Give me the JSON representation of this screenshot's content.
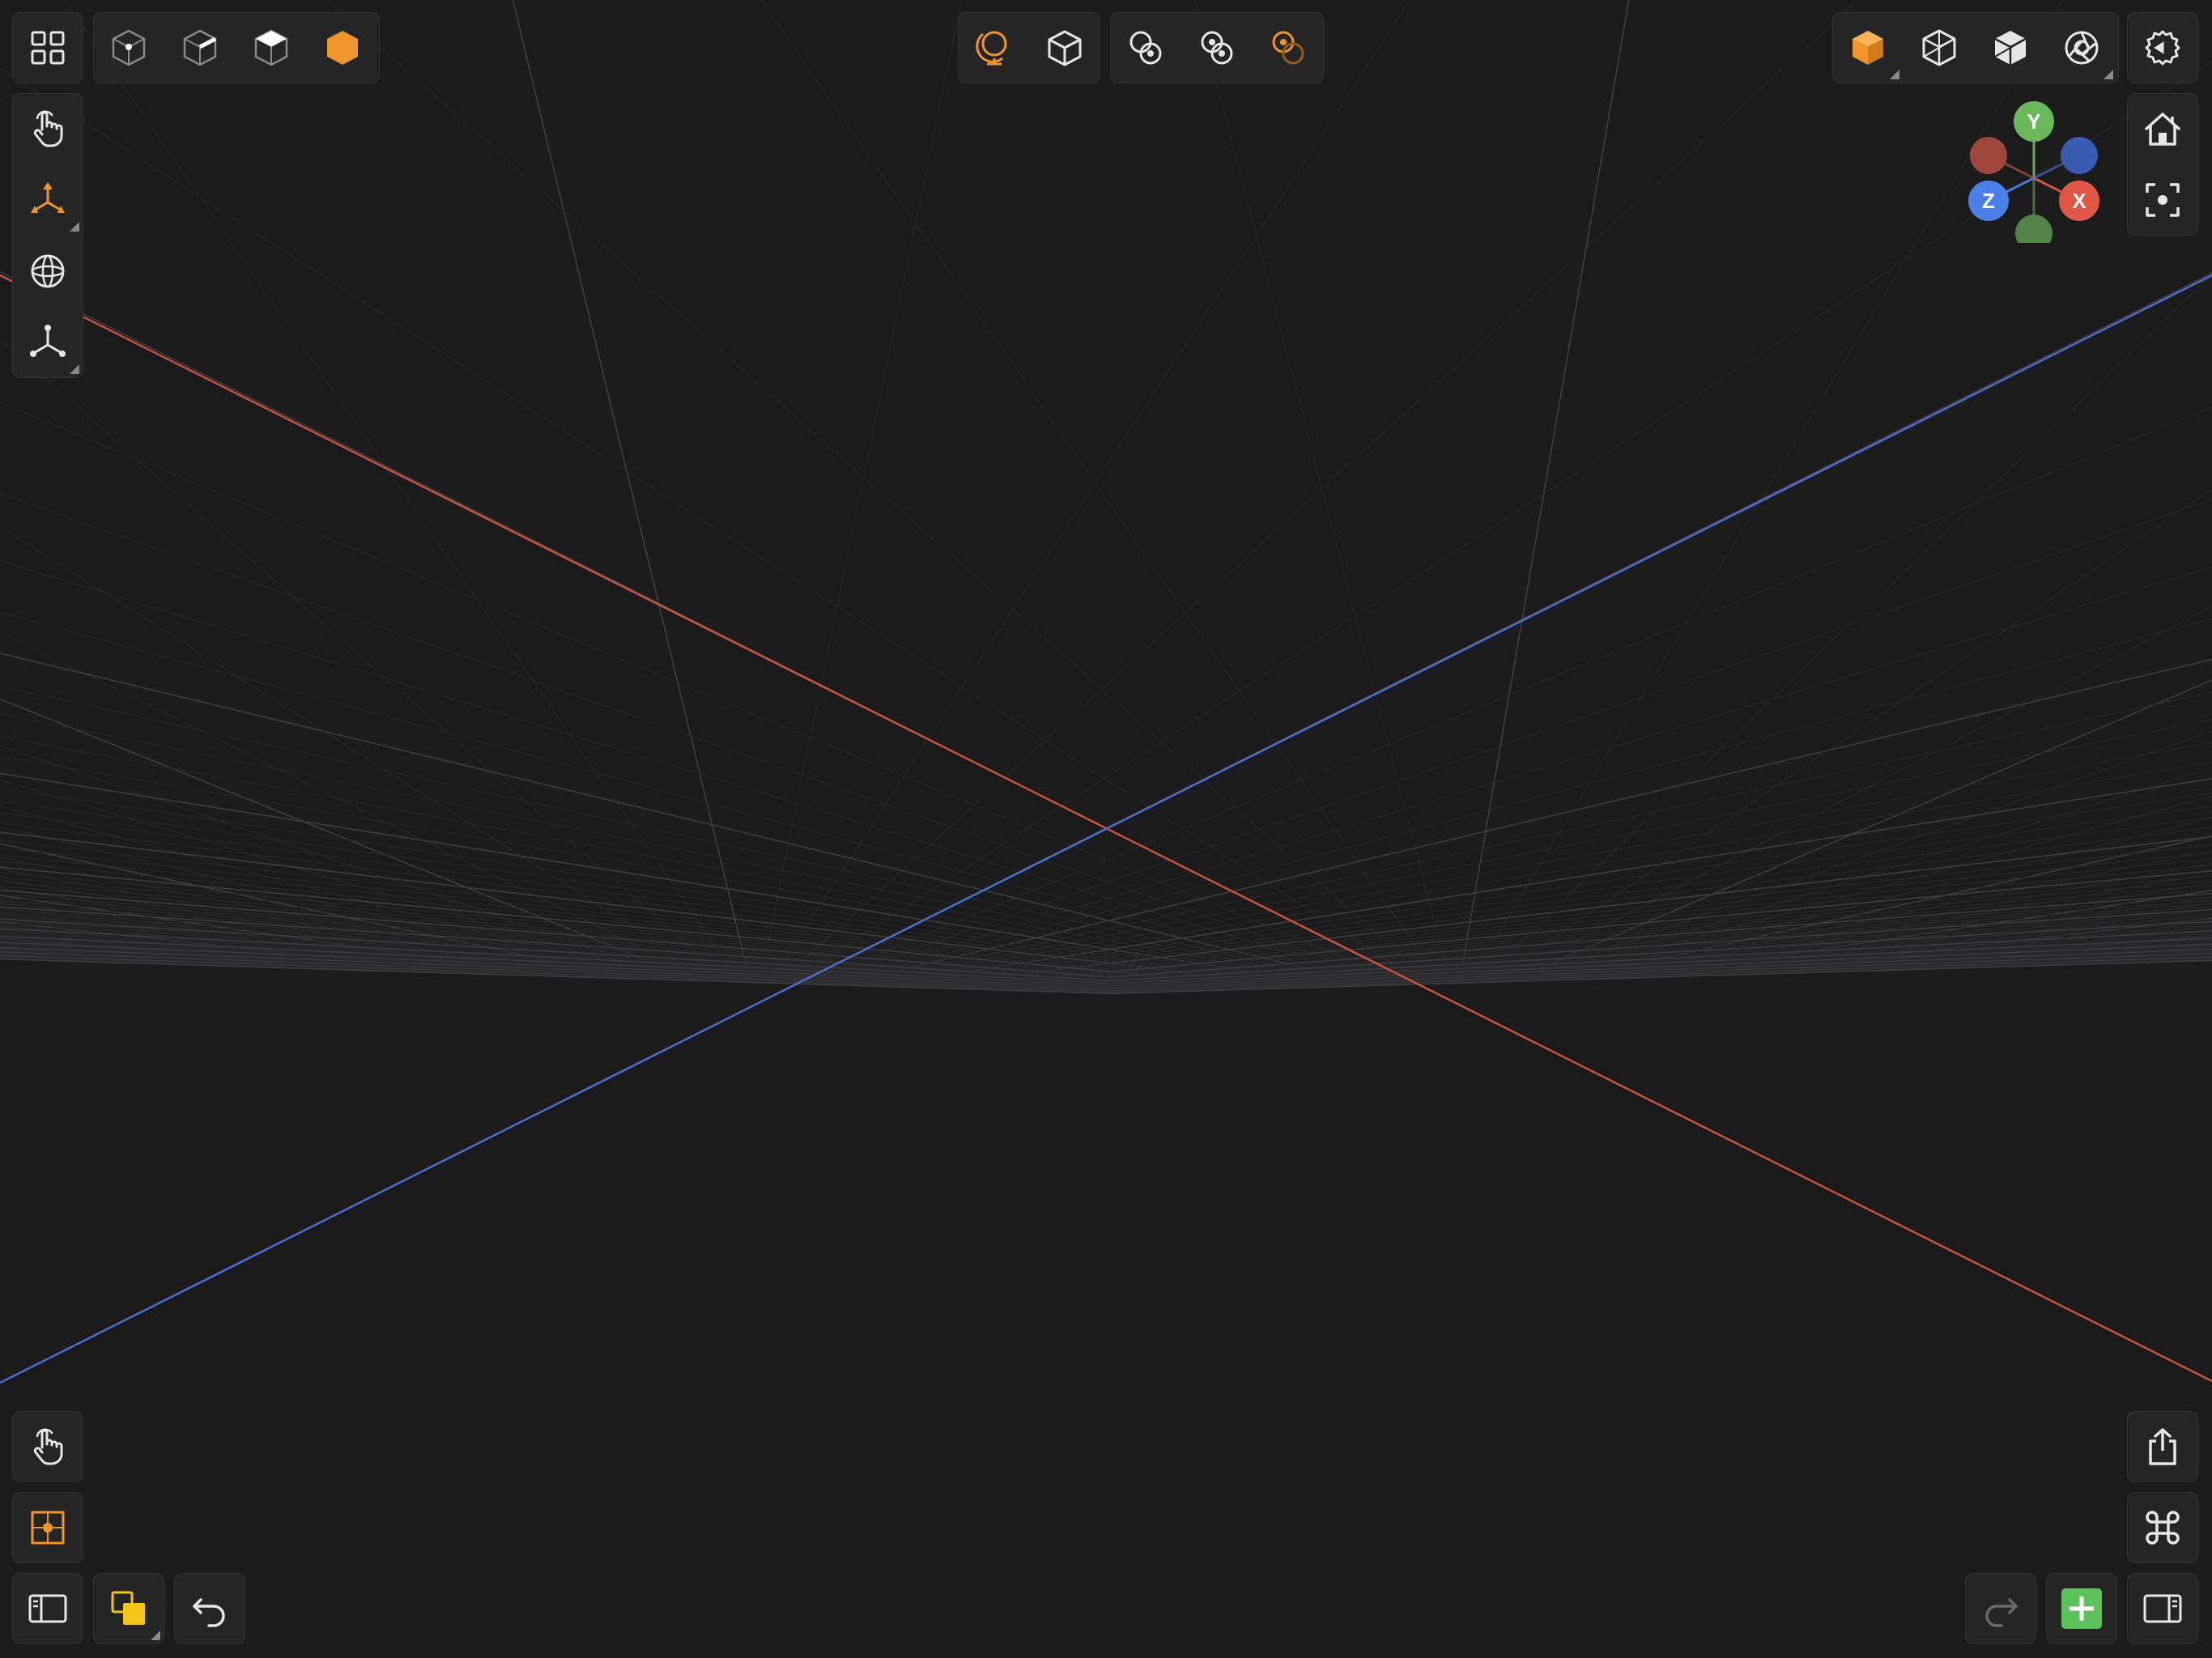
{
  "colors": {
    "background": "#1b1b1c",
    "panel": "#252526",
    "icon": "#e6e6e6",
    "icon_dim": "#9a9a9a",
    "accent_orange": "#f0952b",
    "accent_yellow": "#f5c518",
    "accent_green": "#5cc35c",
    "axis_x": "#d05a4a",
    "axis_y": "#6aa85a",
    "axis_z": "#4a7ad8"
  },
  "top_left": {
    "grid_menu_icon": "grid-menu-icon",
    "selection_modes": [
      "vertex-mode-icon",
      "edge-mode-icon",
      "face-mode-icon",
      "object-mode-icon"
    ],
    "active_selection_mode": "object"
  },
  "top_center": {
    "view_tools": [
      "globe-view-icon",
      "cube-view-icon"
    ],
    "pivot_tools": [
      "pivot-individual-icon",
      "pivot-median-icon",
      "pivot-active-icon"
    ]
  },
  "top_right": {
    "shading_modes": [
      "solid-shading-icon",
      "wireframe-shading-icon",
      "xray-shading-icon",
      "render-shading-icon"
    ],
    "settings_icon": "gear-icon"
  },
  "gizmo": {
    "labels": {
      "x": "X",
      "y": "Y",
      "z": "Z"
    }
  },
  "left_tools": [
    "hand-tool-icon",
    "transform-tool-icon",
    "sphere-tool-icon",
    "axes-tool-icon"
  ],
  "right_tools": [
    "home-icon",
    "focus-icon"
  ],
  "bottom_left": {
    "tools": [
      "hand-tool-icon",
      "snap-icon"
    ],
    "bottom_row": [
      "sidebar-left-icon",
      "layers-icon",
      "undo-icon"
    ]
  },
  "bottom_right": {
    "tools": [
      "share-icon",
      "command-icon"
    ],
    "bottom_row": [
      "redo-icon",
      "add-icon",
      "sidebar-right-icon"
    ]
  }
}
